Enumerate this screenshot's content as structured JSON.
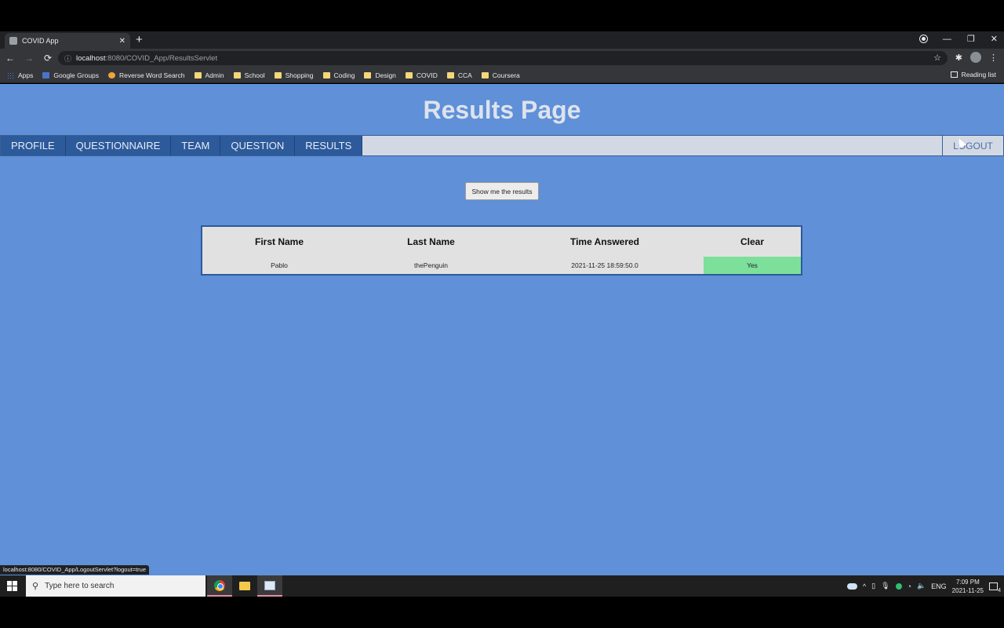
{
  "browser": {
    "tab_title": "COVID App",
    "tab_close": "✕",
    "new_tab": "+",
    "url_host": "localhost",
    "url_path": ":8080/COVID_App/ResultsServlet",
    "window_controls": {
      "minimize": "—",
      "restore": "❐",
      "close": "✕"
    },
    "nav": {
      "back": "←",
      "forward": "→",
      "reload": "⟳"
    },
    "star": "☆",
    "extensions": "✱",
    "menu": "⋮"
  },
  "bookmarks": {
    "items": [
      {
        "label": "Apps",
        "icon": "apps-icon"
      },
      {
        "label": "Google Groups",
        "icon": "groups-icon"
      },
      {
        "label": "Reverse Word Search",
        "icon": "reverse-icon"
      },
      {
        "label": "Admin",
        "icon": "folder-icon"
      },
      {
        "label": "School",
        "icon": "folder-icon"
      },
      {
        "label": "Shopping",
        "icon": "folder-icon"
      },
      {
        "label": "Coding",
        "icon": "folder-icon"
      },
      {
        "label": "Design",
        "icon": "folder-icon"
      },
      {
        "label": "COVID",
        "icon": "folder-icon"
      },
      {
        "label": "CCA",
        "icon": "folder-icon"
      },
      {
        "label": "Coursera",
        "icon": "folder-icon"
      }
    ],
    "reading_list": "Reading list"
  },
  "page": {
    "title": "Results Page",
    "nav_items": [
      "PROFILE",
      "QUESTIONNAIRE",
      "TEAM",
      "QUESTION",
      "RESULTS"
    ],
    "logout": "LOGOUT",
    "show_button": "Show me the results",
    "table": {
      "headers": [
        "First Name",
        "Last Name",
        "Time Answered",
        "Clear"
      ],
      "rows": [
        {
          "first": "Pablo",
          "last": "thePenguin",
          "time": "2021-11-25 18:59:50.0",
          "clear": "Yes"
        }
      ]
    },
    "colors": {
      "background": "#5f90d8",
      "nav": "#2c5a9b",
      "clear_yes": "#7ce09a"
    }
  },
  "status_bar": {
    "url": "localhost:8080/COVID_App/LogoutServlet?logout=true"
  },
  "taskbar": {
    "search_placeholder": "Type here to search",
    "language": "ENG",
    "time": "7:09 PM",
    "date": "2021-11-25",
    "notifications": "4"
  }
}
